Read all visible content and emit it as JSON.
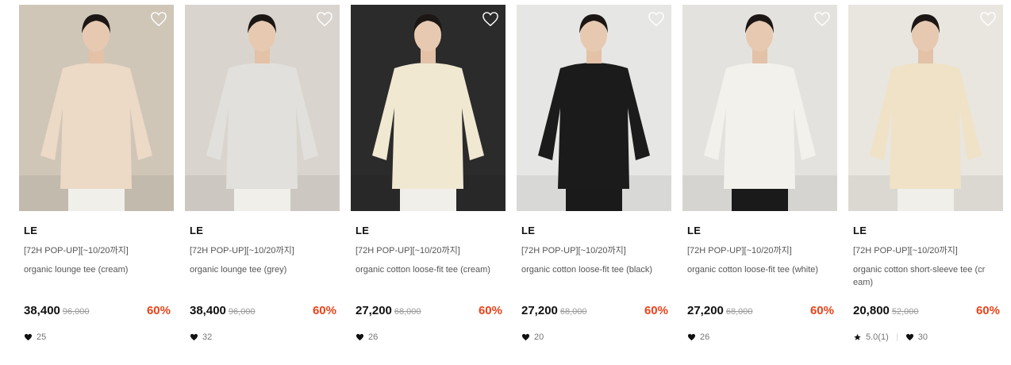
{
  "products": [
    {
      "brand": "LE",
      "promo": "[72H POP-UP][~10/20까지]",
      "name": "organic lounge tee (cream)",
      "price": "38,400",
      "original_price": "96,000",
      "discount": "60%",
      "likes": "25",
      "photo_bg": "#cfc6b8",
      "garment": "#ecd9c6",
      "image": "model-wearing-cream-lounge-tee"
    },
    {
      "brand": "LE",
      "promo": "[72H POP-UP][~10/20까지]",
      "name": "organic lounge tee (grey)",
      "price": "38,400",
      "original_price": "96,000",
      "discount": "60%",
      "likes": "32",
      "photo_bg": "#d9d5ce",
      "garment": "#e2e0dc",
      "image": "model-wearing-grey-lounge-tee"
    },
    {
      "brand": "LE",
      "promo": "[72H POP-UP][~10/20까지]",
      "name": "organic cotton loose-fit tee (cream)",
      "price": "27,200",
      "original_price": "68,000",
      "discount": "60%",
      "likes": "26",
      "photo_bg": "#2b2b2b",
      "garment": "#f1e8d2",
      "image": "model-wearing-cream-loose-fit-tee"
    },
    {
      "brand": "LE",
      "promo": "[72H POP-UP][~10/20까지]",
      "name": "organic cotton loose-fit tee (black)",
      "price": "27,200",
      "original_price": "68,000",
      "discount": "60%",
      "likes": "20",
      "photo_bg": "#e6e6e4",
      "garment": "#1b1b1b",
      "image": "model-wearing-black-loose-fit-tee"
    },
    {
      "brand": "LE",
      "promo": "[72H POP-UP][~10/20까지]",
      "name": "organic cotton loose-fit tee (white)",
      "price": "27,200",
      "original_price": "68,000",
      "discount": "60%",
      "likes": "26",
      "photo_bg": "#e4e2de",
      "garment": "#f3f1ec",
      "image": "model-with-dog-white-loose-fit-tee"
    },
    {
      "brand": "LE",
      "promo": "[72H POP-UP][~10/20까지]",
      "name": "organic cotton short-sleeve tee (cr eam)",
      "price": "20,800",
      "original_price": "52,000",
      "discount": "60%",
      "likes": "30",
      "rating": "5.0(1)",
      "photo_bg": "#e9e6e0",
      "garment": "#efe2c6",
      "image": "model-on-sofa-cream-short-sleeve-tee"
    }
  ],
  "colors": {
    "discount": "#e8441b",
    "price": "#111111",
    "muted": "#999999"
  }
}
